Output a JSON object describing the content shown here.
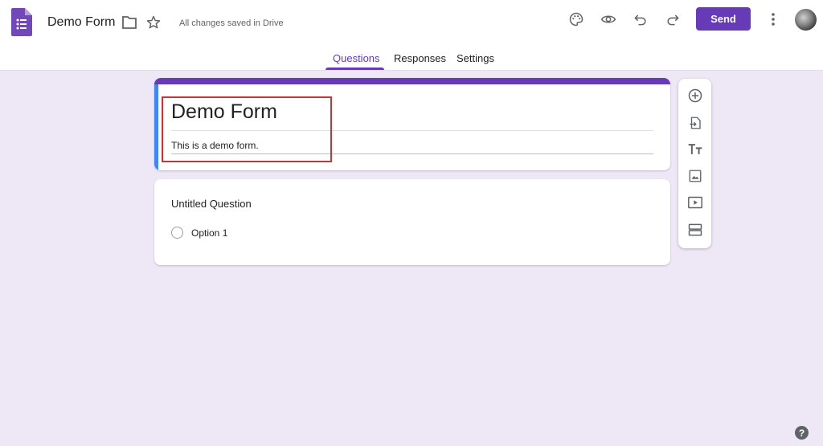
{
  "header": {
    "form_title": "Demo Form",
    "save_status": "All changes saved in Drive",
    "send_label": "Send",
    "icons": [
      "forms-app-icon",
      "folder-icon",
      "star-icon",
      "palette-icon",
      "preview-eye-icon",
      "undo-icon",
      "redo-icon",
      "more-vert-icon",
      "avatar"
    ]
  },
  "tabs": [
    {
      "label": "Questions",
      "active": true
    },
    {
      "label": "Responses",
      "active": false
    },
    {
      "label": "Settings",
      "active": false
    }
  ],
  "title_card": {
    "title": "Demo Form",
    "description": "This is a demo form."
  },
  "question_card": {
    "title": "Untitled Question",
    "options": [
      "Option 1"
    ]
  },
  "toolbar": {
    "icons": [
      "add-question-icon",
      "import-questions-icon",
      "add-title-icon",
      "add-image-icon",
      "add-video-icon",
      "add-section-icon"
    ]
  },
  "help": {
    "label": "?"
  },
  "colors": {
    "accent": "#673ab7",
    "background": "#ede7f6",
    "active_card_bar": "#4285f4",
    "highlight": "#d32f2f"
  }
}
